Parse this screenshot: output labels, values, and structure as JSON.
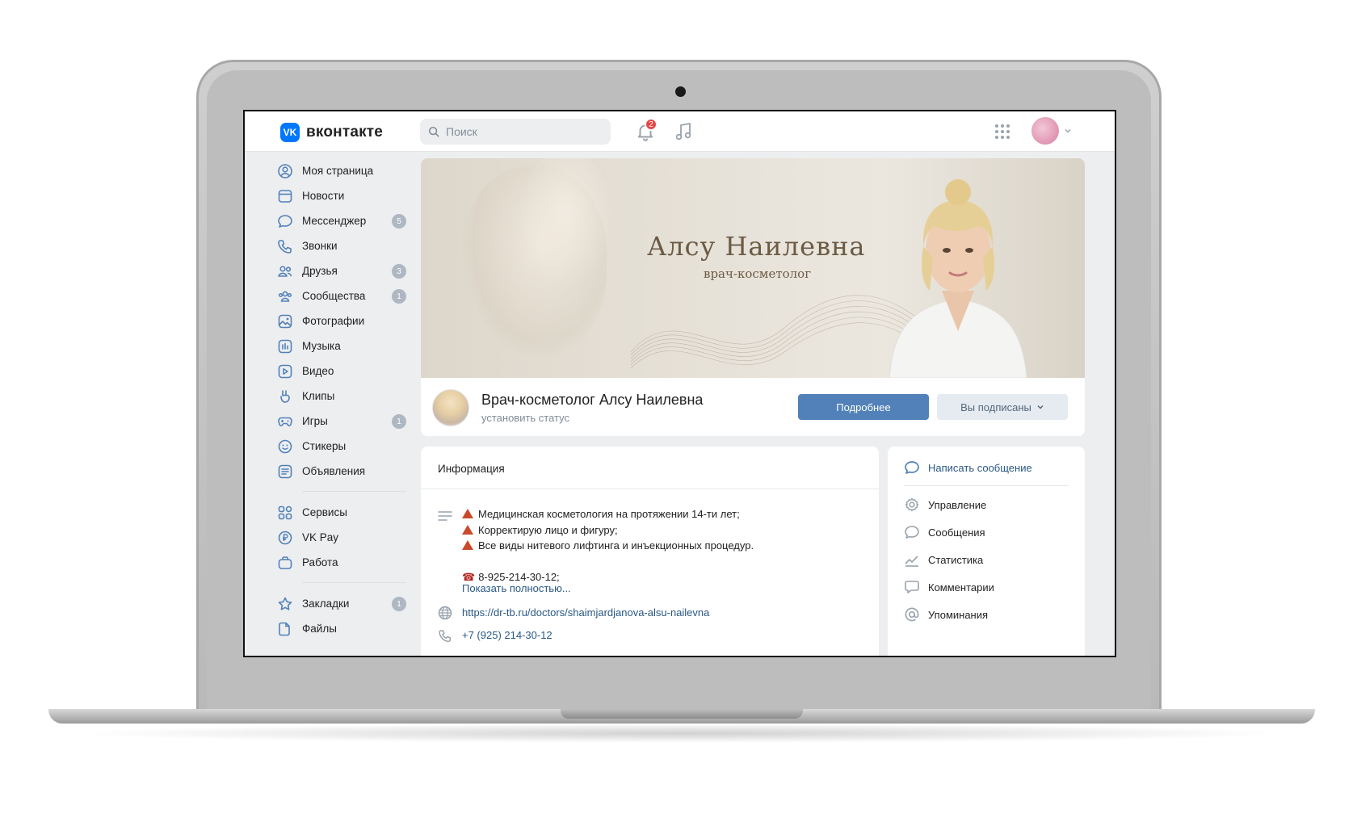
{
  "header": {
    "logo_text": "вконтакте",
    "search_placeholder": "Поиск",
    "notification_count": "2",
    "icons": [
      "bell-icon",
      "music-icon",
      "apps-grid-icon",
      "chevron-down-icon"
    ]
  },
  "sidebar": {
    "items": [
      {
        "label": "Моя страница",
        "icon": "user-circle-icon"
      },
      {
        "label": "Новости",
        "icon": "news-icon"
      },
      {
        "label": "Мессенджер",
        "icon": "chat-icon",
        "badge": "5"
      },
      {
        "label": "Звонки",
        "icon": "phone-icon"
      },
      {
        "label": "Друзья",
        "icon": "friends-icon",
        "badge": "3"
      },
      {
        "label": "Сообщества",
        "icon": "communities-icon",
        "badge": "1"
      },
      {
        "label": "Фотографии",
        "icon": "photo-icon"
      },
      {
        "label": "Музыка",
        "icon": "music-icon"
      },
      {
        "label": "Видео",
        "icon": "video-icon"
      },
      {
        "label": "Клипы",
        "icon": "clips-icon"
      },
      {
        "label": "Игры",
        "icon": "games-icon",
        "badge": "1"
      },
      {
        "label": "Стикеры",
        "icon": "smile-icon"
      },
      {
        "label": "Объявления",
        "icon": "ads-icon"
      }
    ],
    "items2": [
      {
        "label": "Сервисы",
        "icon": "services-icon"
      },
      {
        "label": "VK Pay",
        "icon": "vkpay-icon"
      },
      {
        "label": "Работа",
        "icon": "briefcase-icon"
      }
    ],
    "items3": [
      {
        "label": "Закладки",
        "icon": "star-icon",
        "badge": "1"
      },
      {
        "label": "Файлы",
        "icon": "file-icon"
      }
    ]
  },
  "cover": {
    "title": "Алсу Наилевна",
    "subtitle": "врач-косметолог"
  },
  "profile": {
    "name": "Врач-косметолог Алсу Наилевна",
    "status": "установить статус",
    "more_button": "Подробнее",
    "subscribed_button": "Вы подписаны"
  },
  "info": {
    "title": "Информация",
    "lines": [
      "Медицинская косметология на протяжении 14-ти лет;",
      "Корректирую лицо и фигуру;",
      "Все виды нитевого лифтинга и инъекционных процедур."
    ],
    "phone_line": "8-925-214-30-12;",
    "show_more": "Показать полностью...",
    "site": "https://dr-tb.ru/doctors/shaimjardjanova-alsu-nailevna",
    "phone": "+7 (925) 214-30-12"
  },
  "actions": {
    "write_message": "Написать сообщение",
    "items": [
      "Управление",
      "Сообщения",
      "Статистика",
      "Комментарии",
      "Упоминания"
    ]
  },
  "colors": {
    "accent": "#5181b8",
    "link": "#2a5885",
    "background": "#edeef0",
    "brand": "#0077ff"
  }
}
